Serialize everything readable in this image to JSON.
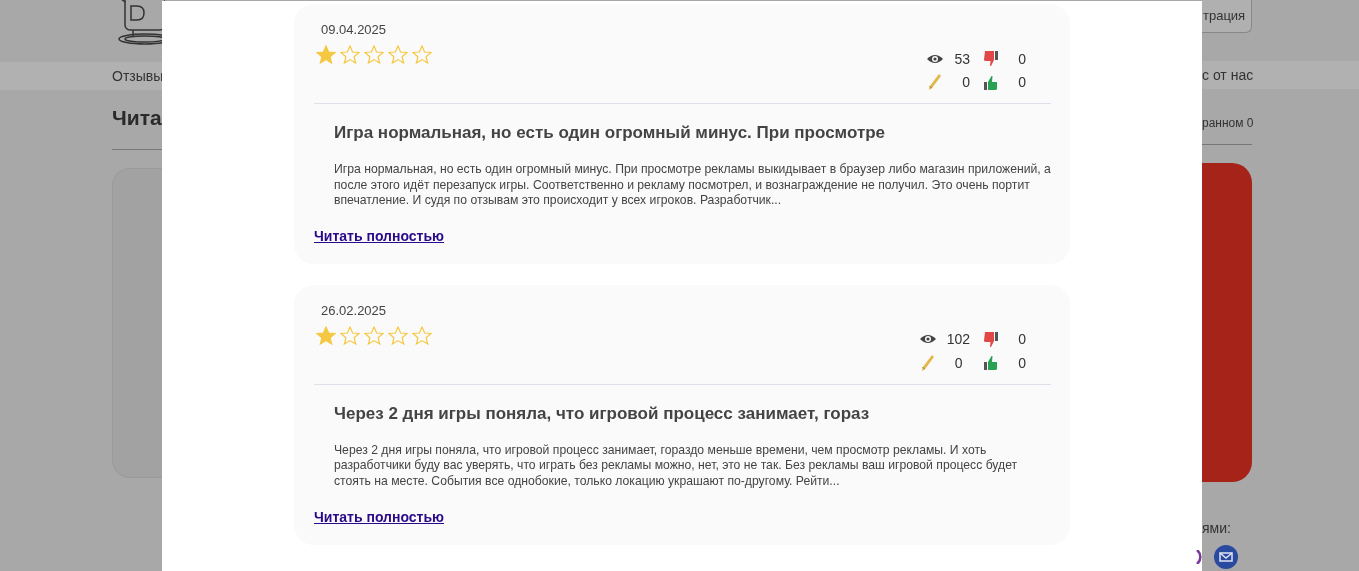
{
  "background": {
    "header_button": "трация",
    "nav": [
      "Отзывы",
      "с от нас"
    ],
    "heading": "Чита",
    "favorites": "ранном 0",
    "share_label": "ями:"
  },
  "reviews": [
    {
      "date": "09.04.2025",
      "stars": 1,
      "views": "53",
      "dislikes": "0",
      "comments": "0",
      "likes": "0",
      "title": "Игра нормальная, но есть один огромный минус. При просмотре",
      "text": "Игра нормальная, но есть один огромный минус. При просмотре рекламы выкидывает в браузер либо магазин приложений, а после этого идёт перезапуск игры. Соответственно и рекламу посмотрел, и вознаграждение не получил. Это очень портит впечатление. И судя по отзывам это происходит у всех игроков. Разработчик...",
      "read_more": "Читать полностью"
    },
    {
      "date": "26.02.2025",
      "stars": 1,
      "views": "102",
      "dislikes": "0",
      "comments": "0",
      "likes": "0",
      "title": "Через 2 дня игры поняла, что игровой процесс занимает, гораз",
      "text": "Через 2 дня игры поняла, что игровой процесс занимает, гораздо меньше времени, чем просмотр рекламы. И хоть разработчики буду вас уверять, что играть без рекламы можно, нет, это не так. Без рекламы ваш игровой процесс будет стоять на месте. События все однобокие, только локацию украшают по-другому. Рейти...",
      "read_more": "Читать полностью"
    }
  ]
}
